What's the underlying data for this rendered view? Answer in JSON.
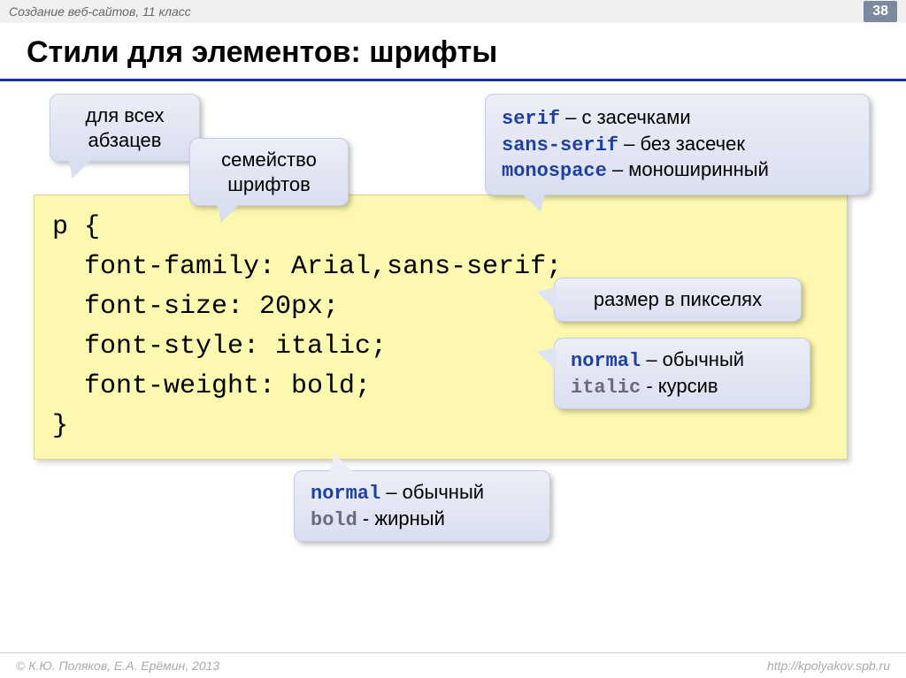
{
  "header": {
    "breadcrumb": "Создание веб-сайтов, 11 класс",
    "page_number": "38"
  },
  "title": "Стили для элементов: шрифты",
  "callouts": {
    "all_paragraphs": "для всех\nабзацев",
    "font_family": "семейство\nшрифтов",
    "generic_families": {
      "serif_kw": "serif",
      "serif_txt": " – с засечками",
      "sans_kw": "sans-serif",
      "sans_txt": " – без засечек",
      "mono_kw": "monospace",
      "mono_txt": " – моноширинный"
    },
    "size": "размер в пикселях",
    "style_values": {
      "normal_kw": "normal",
      "normal_txt": " – обычный",
      "italic_kw": "italic",
      "italic_txt": " - курсив"
    },
    "weight_values": {
      "normal_kw": "normal",
      "normal_txt": " – обычный",
      "bold_kw": "bold",
      "bold_txt": " - жирный"
    }
  },
  "code": {
    "line1": "p {",
    "line2": "  font-family: Arial,sans-serif;",
    "line3": "  font-size: 20px;",
    "line4": "  font-style: italic;",
    "line5": "  font-weight: bold;",
    "line6": "}"
  },
  "footer": {
    "copyright": "© К.Ю. Поляков, Е.А. Ерёмин, 2013",
    "url": "http://kpolyakov.spb.ru"
  }
}
